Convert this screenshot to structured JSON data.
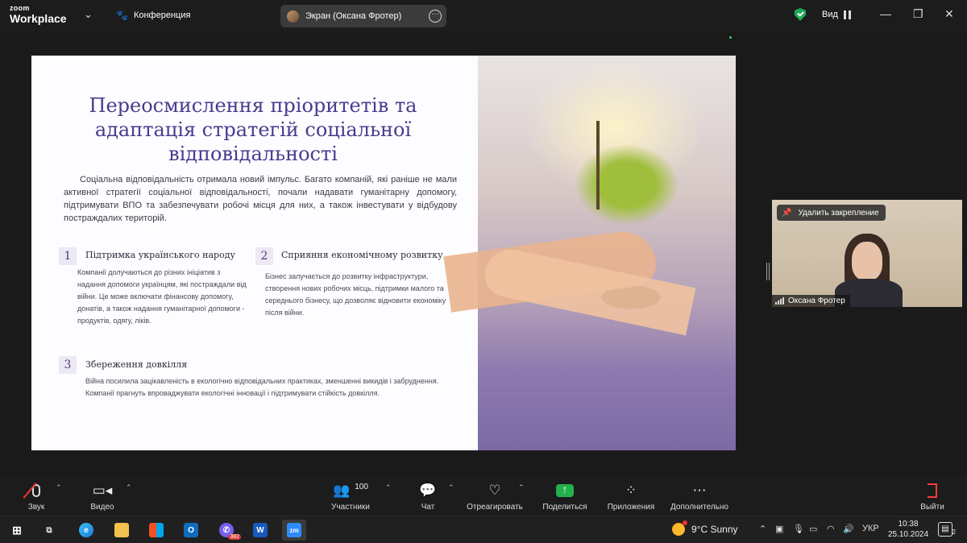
{
  "app": {
    "logo_line1": "zoom",
    "logo_line2": "Workplace"
  },
  "topbar": {
    "meeting_label": "Конференция",
    "share_pill_label": "Экран (Оксана Фротер)",
    "view_label": "Вид"
  },
  "slide": {
    "title": "Переосмислення пріоритетів та адаптація стратегій соціальної відповідальності",
    "intro": "Соціальна відповідальність отримала новий імпульс. Багато компаній, які раніше не мали активної стратегії соціальної відповідальності, почали надавати гуманітарну допомогу, підтримувати ВПО та забезпечувати робочі місця для них, а також інвестувати у відбудову постраждалих територій.",
    "blocks": [
      {
        "num": "1",
        "heading": "Підтримка українського народу",
        "text": "Компанії долучаються до різних ініціатив з надання допомоги українцям, які постраждали від війни. Це може включати фінансову допомогу, донатів, а також надання гуманітарної допомоги - продуктів, одягу, ліків."
      },
      {
        "num": "2",
        "heading": "Сприяння економічному розвитку",
        "text": "Бізнес залучається до розвитку інфраструктури, створення нових робочих місць, підтримки малого та середнього бізнесу, що дозволяє відновити економіку після війни."
      },
      {
        "num": "3",
        "heading": "Збереження довкілля",
        "text": "Війна посилила зацікавленість в екологічно відповідальних практиках, зменшенні викидів і забруднення. Компанії прагнуть впроваджувати екологічні інновації і підтримувати стійкість довкілля."
      }
    ]
  },
  "participant": {
    "unpin_label": "Удалить закрепление",
    "name": "Оксана Фротер"
  },
  "toolbar": {
    "audio_label": "Звук",
    "video_label": "Видео",
    "participants_label": "Участники",
    "participants_count": "100",
    "chat_label": "Чат",
    "react_label": "Отреагировать",
    "share_label": "Поделиться",
    "apps_label": "Приложения",
    "more_label": "Дополнительно",
    "leave_label": "Выйти"
  },
  "taskbar": {
    "viber_badge": "382",
    "weather": "9°C  Sunny",
    "lang": "УКР",
    "time": "10:38",
    "date": "25.10.2024",
    "notifications": "2"
  },
  "colors": {
    "slide_title": "#4b3a8e",
    "share_green": "#24b04b",
    "leave_red": "#ff3b3b"
  }
}
